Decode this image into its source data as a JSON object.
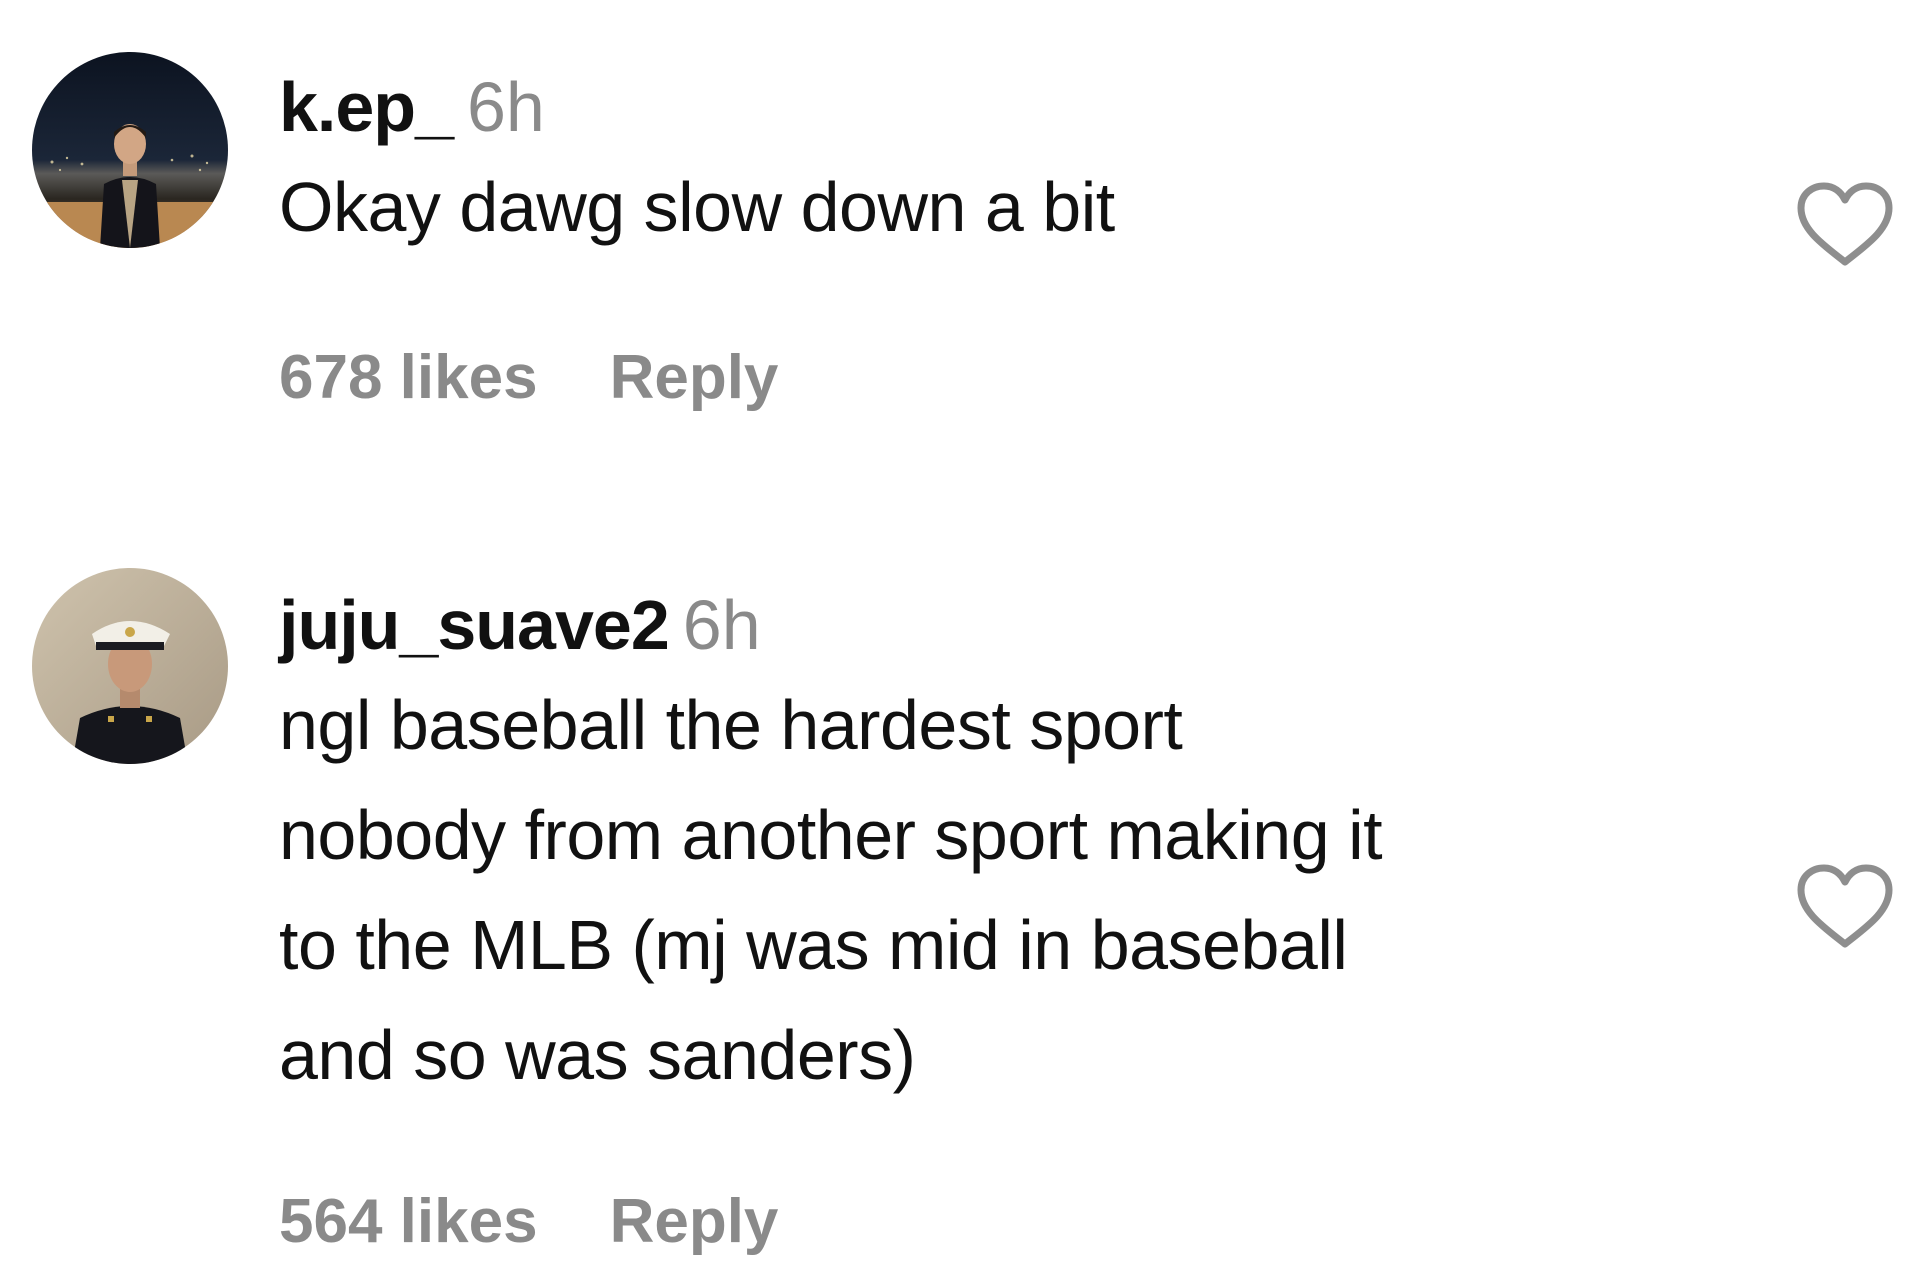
{
  "comments": [
    {
      "username": "k.ep_",
      "time": "6h",
      "text": "Okay dawg slow down a bit",
      "likes": "678 likes",
      "reply": "Reply",
      "avatar_icon": "profile-photo-man-city-night",
      "like_icon": "heart-outline-icon"
    },
    {
      "username": "juju_suave2",
      "time": "6h",
      "text": "ngl baseball the hardest sport\nnobody from another sport making it\nto the MLB (mj was mid in baseball\nand so was sanders)",
      "likes": "564 likes",
      "reply": "Reply",
      "avatar_icon": "profile-photo-man-military-uniform",
      "like_icon": "heart-outline-icon"
    }
  ],
  "colors": {
    "text": "#111111",
    "muted": "#8a8a8a",
    "heart_stroke": "#8e8e8e",
    "background": "#ffffff"
  }
}
